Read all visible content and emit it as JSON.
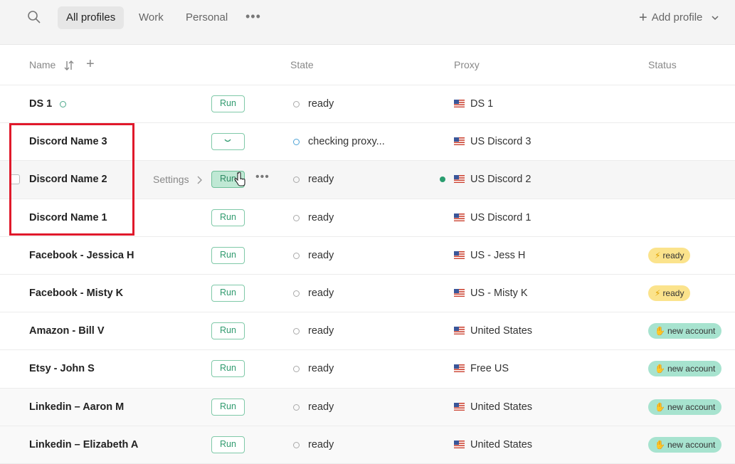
{
  "tabs": [
    {
      "label": "All profiles",
      "active": true
    },
    {
      "label": "Work",
      "active": false
    },
    {
      "label": "Personal",
      "active": false
    }
  ],
  "add_profile_label": "Add profile",
  "columns": {
    "name": "Name",
    "state": "State",
    "proxy": "Proxy",
    "status": "Status"
  },
  "hover_row": {
    "settings_label": "Settings"
  },
  "run_label": "Run",
  "rows": [
    {
      "name": "DS 1",
      "state": "ready",
      "proxy": "DS 1",
      "status": ""
    },
    {
      "name": "Discord Name 3",
      "state": "checking proxy...",
      "proxy": "US Discord 3",
      "status": ""
    },
    {
      "name": "Discord Name 2",
      "state": "ready",
      "proxy": "US Discord 2",
      "status": ""
    },
    {
      "name": "Discord Name 1",
      "state": "ready",
      "proxy": "US Discord 1",
      "status": ""
    },
    {
      "name": "Facebook - Jessica H",
      "state": "ready",
      "proxy": "US - Jess H",
      "status": "ready"
    },
    {
      "name": "Facebook - Misty K",
      "state": "ready",
      "proxy": "US - Misty K",
      "status": "ready"
    },
    {
      "name": "Amazon - Bill V",
      "state": "ready",
      "proxy": "United States",
      "status": "new account"
    },
    {
      "name": "Etsy - John S",
      "state": "ready",
      "proxy": "Free US",
      "status": "new account"
    },
    {
      "name": "Linkedin – Aaron M",
      "state": "ready",
      "proxy": "United States",
      "status": "new account"
    },
    {
      "name": "Linkedin – Elizabeth A",
      "state": "ready",
      "proxy": "United States",
      "status": "new account"
    }
  ],
  "colors": {
    "accent": "#2f9a6e",
    "highlight": "#e0192b",
    "ready_badge": "#fbe38c",
    "new_badge": "#a7e3cf"
  }
}
